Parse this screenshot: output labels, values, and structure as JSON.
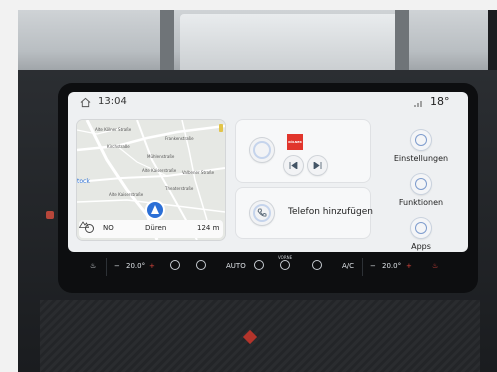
{
  "status": {
    "time": "13:04",
    "temperature": "18°"
  },
  "map": {
    "labels": [
      "Alte Kölner Straße",
      "Frankenstraße",
      "Kirchstraße",
      "Mühlenstraße",
      "Alte Kaiserstraße",
      "Valbener Straße",
      "Alte Kaiserstraße",
      "Theaterstraße"
    ],
    "left_partial": "tock",
    "heading": "NO",
    "city": "Düren",
    "altitude": "124 m"
  },
  "media": {
    "station": "KÖLNER",
    "buttons": [
      "prev-icon",
      "next-icon"
    ]
  },
  "phone": {
    "label": "Telefon hinzufügen"
  },
  "side": [
    {
      "label": "Einstellungen",
      "icon": "settings-icon"
    },
    {
      "label": "Funktionen",
      "icon": "car-icon"
    },
    {
      "label": "Apps",
      "icon": "apps-icon"
    }
  ],
  "climate": {
    "left_temp": "20.0°",
    "right_temp": "20.0°",
    "auto": "AUTO",
    "ac": "A/C",
    "vorne": "VORNE",
    "minus": "−",
    "plus": "+"
  },
  "colors": {
    "accent_blue": "#2b6fd6",
    "red": "#e1352c"
  }
}
